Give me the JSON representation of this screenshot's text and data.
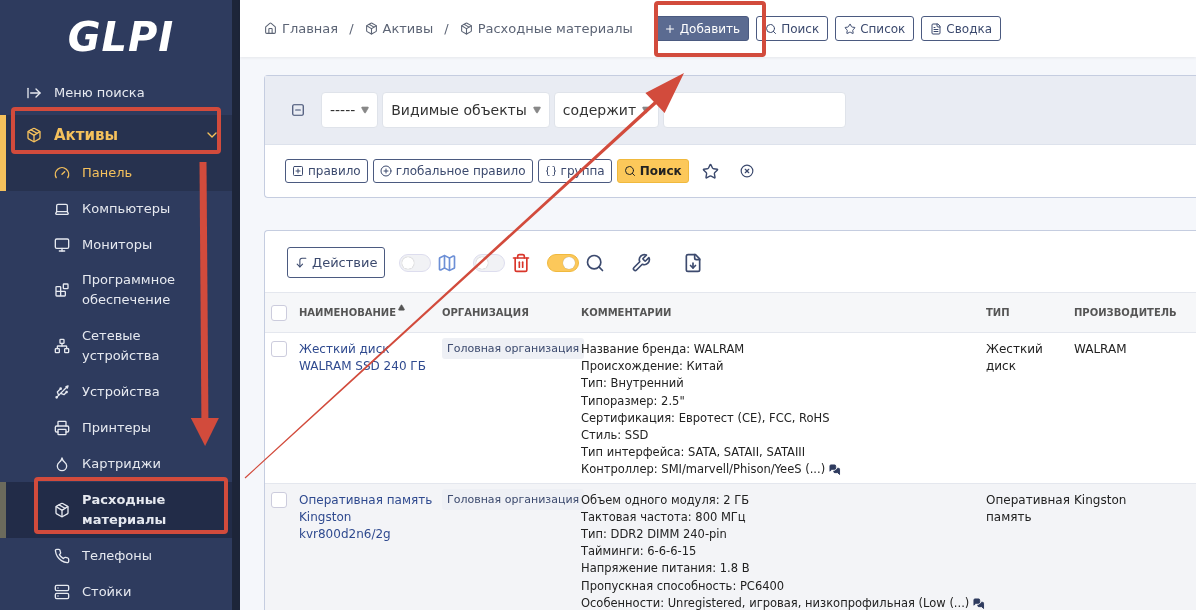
{
  "logo": {
    "text": "GLPI"
  },
  "sidebar": {
    "search_menu": "Меню поиска",
    "section": {
      "label": "Активы",
      "expanded": true
    },
    "items": [
      {
        "label": "Панель",
        "active": true,
        "selected": false
      },
      {
        "label": "Компьютеры",
        "active": false,
        "selected": false
      },
      {
        "label": "Мониторы",
        "active": false,
        "selected": false
      },
      {
        "label": "Программное обеспечение",
        "active": false,
        "selected": false
      },
      {
        "label": "Сетевые устройства",
        "active": false,
        "selected": false
      },
      {
        "label": "Устройства",
        "active": false,
        "selected": false
      },
      {
        "label": "Принтеры",
        "active": false,
        "selected": false
      },
      {
        "label": "Картриджи",
        "active": false,
        "selected": false
      },
      {
        "label": "Расходные материалы",
        "active": false,
        "selected": true
      },
      {
        "label": "Телефоны",
        "active": false,
        "selected": false
      },
      {
        "label": "Стойки",
        "active": false,
        "selected": false
      }
    ]
  },
  "breadcrumbs": [
    "Главная",
    "Активы",
    "Расходные материалы"
  ],
  "breadcrumb_separator": "/",
  "header_buttons": [
    {
      "label": "Добавить",
      "primary": true
    },
    {
      "label": "Поиск",
      "primary": false
    },
    {
      "label": "Список",
      "primary": false
    },
    {
      "label": "Сводка",
      "primary": false
    }
  ],
  "filter": {
    "selects": [
      "-----",
      "Видимые объекты",
      "содержит"
    ],
    "buttons": [
      "правило",
      "глобальное правило",
      "группа"
    ],
    "search_button": "Поиск"
  },
  "toolbar": {
    "action_button": "Действие",
    "toggles": [
      {
        "on": false
      },
      {
        "on": false
      },
      {
        "on": true
      }
    ]
  },
  "table": {
    "all_checked": false,
    "columns": [
      {
        "label": "НАИМЕНОВАНИЕ",
        "sorted": true
      },
      {
        "label": "ОРГАНИЗАЦИЯ",
        "sorted": false
      },
      {
        "label": "КОММЕНТАРИИ",
        "sorted": false
      },
      {
        "label": "ТИП",
        "sorted": false
      },
      {
        "label": "ПРОИЗВОДИТЕЛЬ",
        "sorted": false
      }
    ],
    "rows": [
      {
        "checked": false,
        "name": "Жесткий диск WALRAM SSD 240 ГБ",
        "organization": "Головная организация",
        "comments": [
          "Название бренда: WALRAM",
          "Происхождение: Китай",
          "Тип: Внутренний",
          "Типоразмер: 2.5\"",
          "Сертификация: Евротест (CE), FCC, RoHS",
          "Стиль: SSD",
          "Тип интерфейса: SATA, SATAII, SATAIII",
          "Контроллер: SMI/marvell/Phison/YeeS (...)"
        ],
        "type": "Жесткий диск",
        "manufacturer": "WALRAM"
      },
      {
        "checked": false,
        "name": "Оперативная память Kingston kvr800d2n6/2g",
        "organization": "Головная организация",
        "comments": [
          "Объем одного модуля: 2 ГБ",
          "Тактовая частота: 800 МГц",
          "Тип: DDR2 DIMM 240-pin",
          "Тайминги: 6-6-6-15",
          "Напряжение питания: 1.8 В",
          "Пропускная способность: PC6400",
          "Особенности: Unregistered, игровая, низкопрофильная (Low  (...)"
        ],
        "type": "Оперативная память",
        "manufacturer": "Kingston"
      }
    ]
  }
}
